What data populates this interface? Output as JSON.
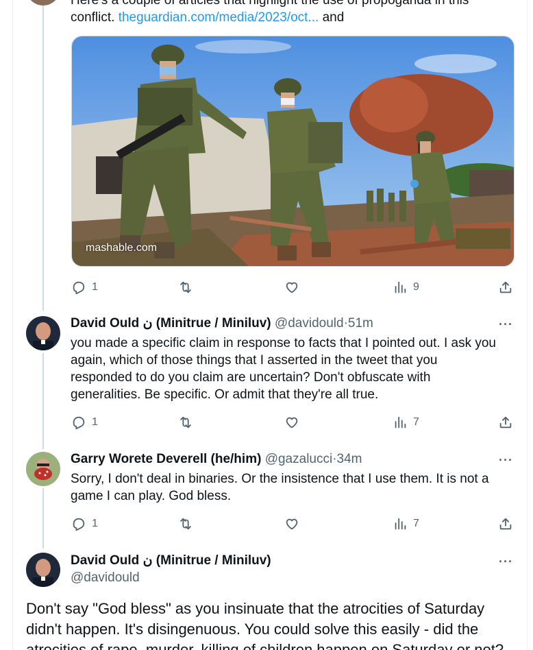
{
  "tweet1": {
    "text_top": "Here's a couple of articles that highlight the use of propoganda in this",
    "text_prefix": "conflict.",
    "link": "theguardian.com/media/2023/oct...",
    "text_suffix": "and",
    "media_label": "mashable.com",
    "replies": "1",
    "views": "9"
  },
  "tweet2": {
    "name": "David Ould ن (Minitrue / Miniluv)",
    "handle": "@davidould",
    "time": "51m",
    "lines": [
      "you made a specific claim in response to facts that I pointed out. I ask you",
      "again, which of those things that I asserted in the tweet that you",
      "responded to do you claim are uncertain? Don't obfuscate with",
      "generalities. Be specific. Or admit that they're all true."
    ],
    "replies": "1",
    "views": "7"
  },
  "tweet3": {
    "name": "Garry Worete Deverell (he/him)",
    "handle": "@gazalucci",
    "time": "34m",
    "lines": [
      "Sorry, I don't deal in binaries. Or the insistence that I use them. It is not a",
      "game I can play. God bless."
    ],
    "replies": "1",
    "views": "7"
  },
  "main": {
    "name": "David Ould ن (Minitrue / Miniluv)",
    "handle": "@davidould",
    "lines": [
      "Don't say \"God bless\" as you insinuate that the atrocities of Saturday",
      "didn't happen. It's disingenuous. You could solve this easily - did the",
      "atrocities of rape, murder, killing of children happen on Saturday or not?"
    ]
  },
  "separator": "·",
  "more": "···"
}
